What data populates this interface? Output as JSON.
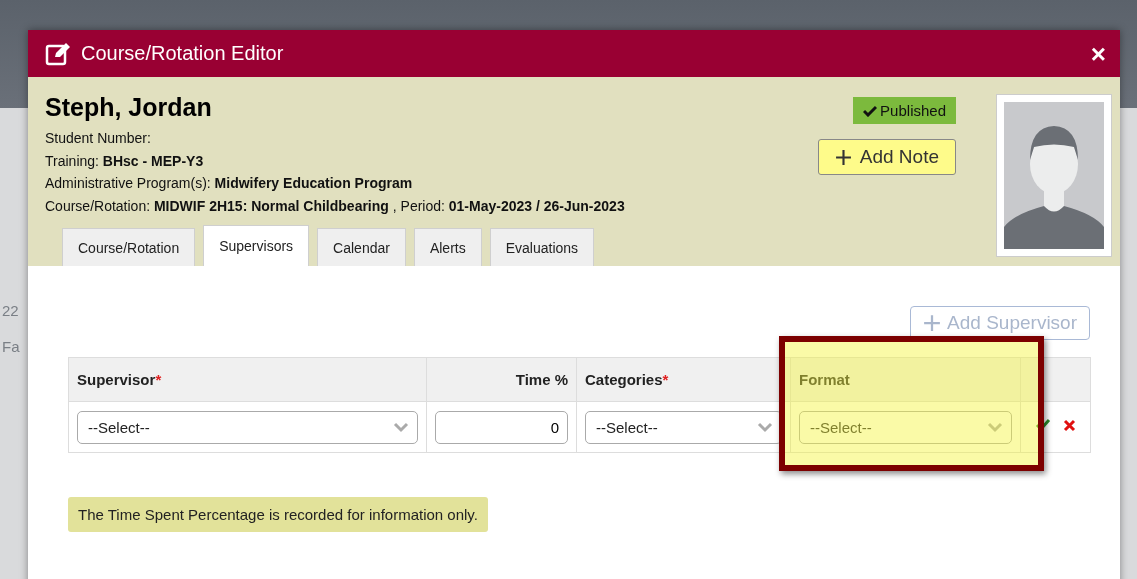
{
  "background": {
    "fragments": [
      "22",
      "Fa"
    ]
  },
  "dialog": {
    "title": "Course/Rotation Editor",
    "close": "×"
  },
  "student": {
    "name": "Steph, Jordan",
    "fields": [
      {
        "label": "Student Number:"
      },
      {
        "label": "Training:",
        "value": "BHsc - MEP-Y3"
      },
      {
        "label": "Administrative Program(s):",
        "value": "Midwifery Education Program"
      },
      {
        "label": "Course/Rotation:",
        "value": "MIDWIF 2H15: Normal Childbearing",
        "extra_label": ", Period:",
        "extra_value": "01-May-2023 / 26-Jun-2023"
      }
    ],
    "status": "Published",
    "add_note": "Add Note"
  },
  "tabs": [
    {
      "label": "Course/Rotation",
      "selected": false
    },
    {
      "label": "Supervisors",
      "selected": true
    },
    {
      "label": "Calendar",
      "selected": false
    },
    {
      "label": "Alerts",
      "selected": false
    },
    {
      "label": "Evaluations",
      "selected": false
    }
  ],
  "add_supervisor": {
    "label": "Add Supervisor",
    "disabled": true
  },
  "table": {
    "columns": [
      {
        "label": "Supervisor",
        "required_mark": "*",
        "kind": "select",
        "highlighted": false
      },
      {
        "label": "Time %",
        "kind": "number",
        "highlighted": false
      },
      {
        "label": "Categories",
        "required_mark": "*",
        "kind": "select",
        "highlighted": false
      },
      {
        "label": "Format",
        "kind": "select",
        "highlighted": true
      }
    ],
    "row": {
      "supervisor": "--Select--",
      "time": "0",
      "categories": "--Select--",
      "format": "--Select--"
    }
  },
  "note": "The Time Spent Percentage is recorded for information only."
}
